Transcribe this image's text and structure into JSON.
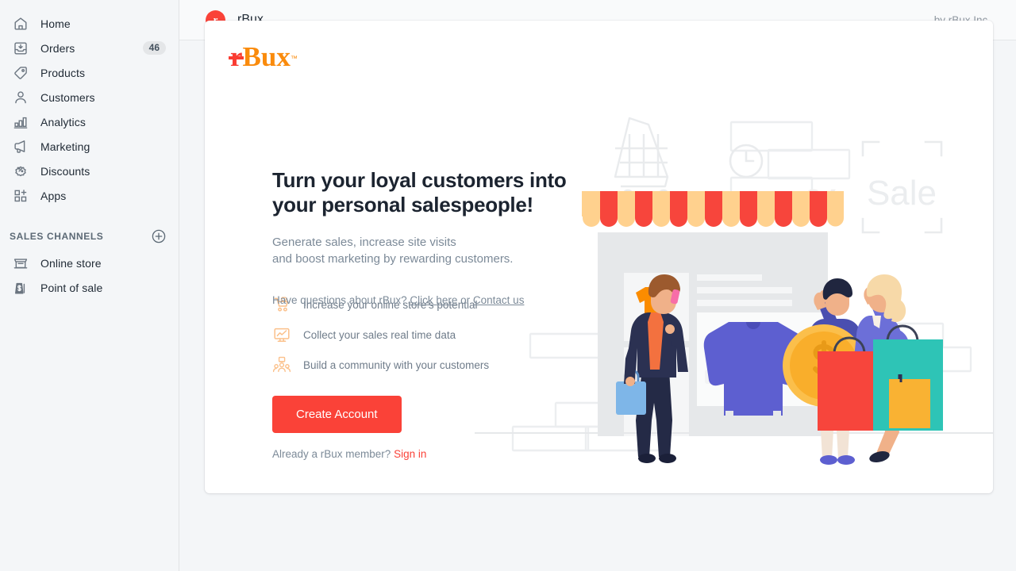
{
  "sidebar": {
    "items": [
      {
        "label": "Home",
        "icon": "home-icon",
        "badge": ""
      },
      {
        "label": "Orders",
        "icon": "orders-inbox-icon",
        "badge": "46"
      },
      {
        "label": "Products",
        "icon": "tag-icon",
        "badge": ""
      },
      {
        "label": "Customers",
        "icon": "person-icon",
        "badge": ""
      },
      {
        "label": "Analytics",
        "icon": "bar-chart-icon",
        "badge": ""
      },
      {
        "label": "Marketing",
        "icon": "megaphone-icon",
        "badge": ""
      },
      {
        "label": "Discounts",
        "icon": "percent-badge-icon",
        "badge": ""
      },
      {
        "label": "Apps",
        "icon": "apps-grid-plus-icon",
        "badge": ""
      }
    ],
    "section": {
      "title": "SALES CHANNELS",
      "add_icon": "plus-circle-icon",
      "channels": [
        {
          "label": "Online store",
          "icon": "storefront-icon"
        },
        {
          "label": "Point of sale",
          "icon": "point-of-sale-icon"
        }
      ]
    }
  },
  "topbar": {
    "app_initial": "r",
    "app_name": "rBux",
    "byline": "by rBux Inc."
  },
  "card": {
    "logo": {
      "r": "r",
      "bux": "Bux",
      "tm": "™"
    },
    "headline_line1": "Turn your loyal customers into",
    "headline_line2": "your personal salespeople!",
    "subhead_line1": "Generate sales, increase site visits",
    "subhead_line2": "and boost marketing by rewarding customers.",
    "features": [
      {
        "icon": "cart-heart-icon",
        "text": "Increase your online store's potential"
      },
      {
        "icon": "monitor-chart-icon",
        "text": "Collect your sales real time data"
      },
      {
        "icon": "community-people-icon",
        "text": "Build a community with your customers"
      }
    ],
    "cta_label": "Create Account",
    "signin_prefix": "Already a rBux member? ",
    "signin_link": "Sign in",
    "questions_prefix": "Have questions about rBux? ",
    "questions_link1": "Click here",
    "questions_mid": " or ",
    "questions_link2": "Contact us",
    "illustration": {
      "sale_label": "Sale",
      "percent_label": "%"
    }
  },
  "colors": {
    "accent_red": "#fa4238",
    "accent_orange": "#fa8b0c",
    "awning_red": "#f7453c",
    "awning_peach": "#ffd18e",
    "page_bg": "#f4f6f8",
    "card_bg": "#ffffff",
    "text_dark": "#1c2430",
    "text_muted": "#7c8a98"
  }
}
